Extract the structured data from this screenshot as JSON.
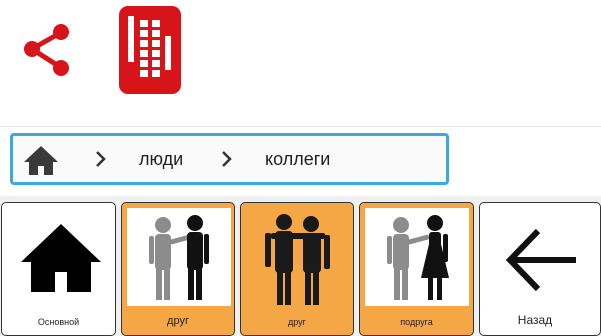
{
  "colors": {
    "accent_red": "#d8141b",
    "breadcrumb_border": "#3aa9dd",
    "tile_orange": "#f6a745"
  },
  "toolbar": {
    "share_icon": "share-icon",
    "keypad_icon": "keypad-icon"
  },
  "breadcrumb": {
    "home_icon": "home-icon",
    "items": [
      "люди",
      "коллеги"
    ]
  },
  "tiles": [
    {
      "label": "Основной",
      "icon": "house-icon",
      "style": "white"
    },
    {
      "label": "друг",
      "icon": "two-men-friends-icon",
      "style": "orange"
    },
    {
      "label": "друг",
      "icon": "two-men-embracing-icon",
      "style": "orange"
    },
    {
      "label": "подруга",
      "icon": "man-and-woman-friends-icon",
      "style": "orange"
    },
    {
      "label": "Назад",
      "icon": "arrow-left-icon",
      "style": "white"
    }
  ]
}
